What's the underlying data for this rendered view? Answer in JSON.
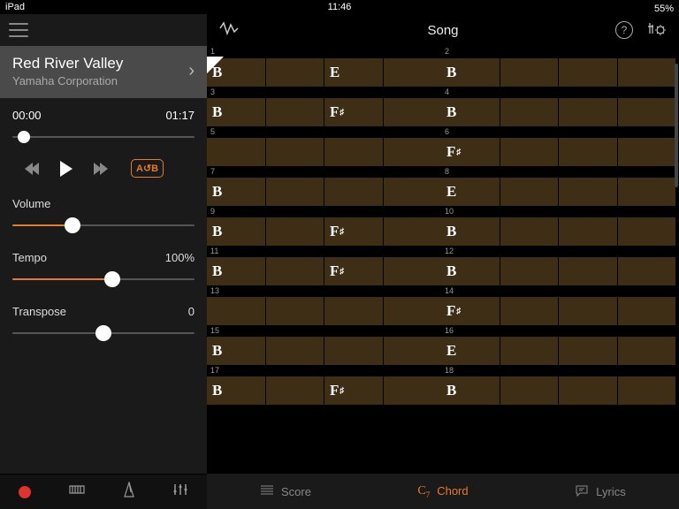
{
  "status": {
    "device": "iPad",
    "time": "11:46",
    "battery_pct": "55%"
  },
  "header": {
    "title": "Song"
  },
  "song": {
    "title": "Red River Valley",
    "artist": "Yamaha Corporation"
  },
  "playback": {
    "elapsed": "00:00",
    "total": "01:17",
    "progress_pct": 3,
    "ab_label": "A↺B"
  },
  "controls": {
    "volume": {
      "label": "Volume",
      "value_pct": 33
    },
    "tempo": {
      "label": "Tempo",
      "display": "100%",
      "value_pct": 55
    },
    "transpose": {
      "label": "Transpose",
      "display": "0",
      "value_pct": 50
    }
  },
  "bottom_tabs": {
    "score": "Score",
    "chord": "Chord",
    "lyrics": "Lyrics",
    "active": "chord"
  },
  "chord_rows": [
    {
      "bars": [
        {
          "n": 1,
          "beats": [
            "B",
            "",
            "E",
            ""
          ]
        },
        {
          "n": 2,
          "beats": [
            "B",
            "",
            "",
            ""
          ]
        }
      ],
      "cursor": true
    },
    {
      "bars": [
        {
          "n": 3,
          "beats": [
            "B",
            "",
            "F♯",
            ""
          ]
        },
        {
          "n": 4,
          "beats": [
            "B",
            "",
            "",
            ""
          ]
        }
      ]
    },
    {
      "bars": [
        {
          "n": 5,
          "beats": [
            "",
            "",
            "",
            ""
          ]
        },
        {
          "n": 6,
          "beats": [
            "F♯",
            "",
            "",
            ""
          ]
        }
      ]
    },
    {
      "bars": [
        {
          "n": 7,
          "beats": [
            "B",
            "",
            "",
            ""
          ]
        },
        {
          "n": 8,
          "beats": [
            "E",
            "",
            "",
            ""
          ]
        }
      ]
    },
    {
      "bars": [
        {
          "n": 9,
          "beats": [
            "B",
            "",
            "F♯",
            ""
          ]
        },
        {
          "n": 10,
          "beats": [
            "B",
            "",
            "",
            ""
          ]
        }
      ]
    },
    {
      "bars": [
        {
          "n": 11,
          "beats": [
            "B",
            "",
            "F♯",
            ""
          ]
        },
        {
          "n": 12,
          "beats": [
            "B",
            "",
            "",
            ""
          ]
        }
      ]
    },
    {
      "bars": [
        {
          "n": 13,
          "beats": [
            "",
            "",
            "",
            ""
          ]
        },
        {
          "n": 14,
          "beats": [
            "F♯",
            "",
            "",
            ""
          ]
        }
      ]
    },
    {
      "bars": [
        {
          "n": 15,
          "beats": [
            "B",
            "",
            "",
            ""
          ]
        },
        {
          "n": 16,
          "beats": [
            "E",
            "",
            "",
            ""
          ]
        }
      ]
    },
    {
      "bars": [
        {
          "n": 17,
          "beats": [
            "B",
            "",
            "F♯",
            ""
          ]
        },
        {
          "n": 18,
          "beats": [
            "B",
            "",
            "",
            ""
          ]
        }
      ]
    }
  ],
  "colors": {
    "accent": "#e67a2e",
    "chord_bg": "#3d2e15"
  }
}
